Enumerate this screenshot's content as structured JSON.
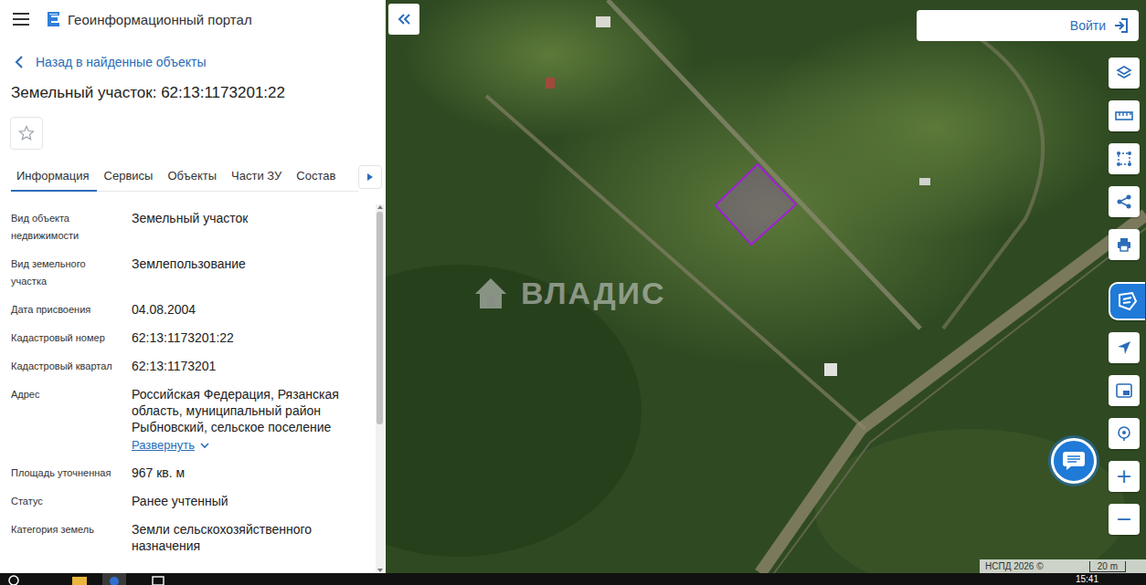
{
  "header": {
    "title": "Геоинформационный портал"
  },
  "back_link": "Назад в найденные объекты",
  "object_title": "Земельный участок: 62:13:1173201:22",
  "favorite": false,
  "tabs": [
    {
      "label": "Информация",
      "selected": true
    },
    {
      "label": "Сервисы",
      "selected": false
    },
    {
      "label": "Объекты",
      "selected": false
    },
    {
      "label": "Части ЗУ",
      "selected": false
    },
    {
      "label": "Состав",
      "selected": false
    }
  ],
  "properties": [
    {
      "label": "Вид объекта недвижимости",
      "value": "Земельный участок"
    },
    {
      "label": "Вид земельного участка",
      "value": "Землепользование"
    },
    {
      "label": "Дата присвоения",
      "value": "04.08.2004"
    },
    {
      "label": "Кадастровый номер",
      "value": "62:13:1173201:22"
    },
    {
      "label": "Кадастровый квартал",
      "value": "62:13:1173201"
    },
    {
      "label": "Адрес",
      "value": "Российская Федерация, Рязанская область, муниципальный район Рыбновский, сельское поселение",
      "expand": "Развернуть"
    },
    {
      "label": "Площадь уточненная",
      "value": "967 кв. м"
    },
    {
      "label": "Статус",
      "value": "Ранее учтенный"
    },
    {
      "label": "Категория земель",
      "value": "Земли сельскохозяйственного назначения"
    }
  ],
  "scrollbar": {
    "level": 0.6
  },
  "map": {
    "login": "Войти",
    "watermark": "ВЛАДИС",
    "zoom_in": "+",
    "zoom_out": "−",
    "attribution": "НСПД 2026 ©",
    "scale": "20 m"
  },
  "taskbar": {
    "time": "15:41"
  }
}
